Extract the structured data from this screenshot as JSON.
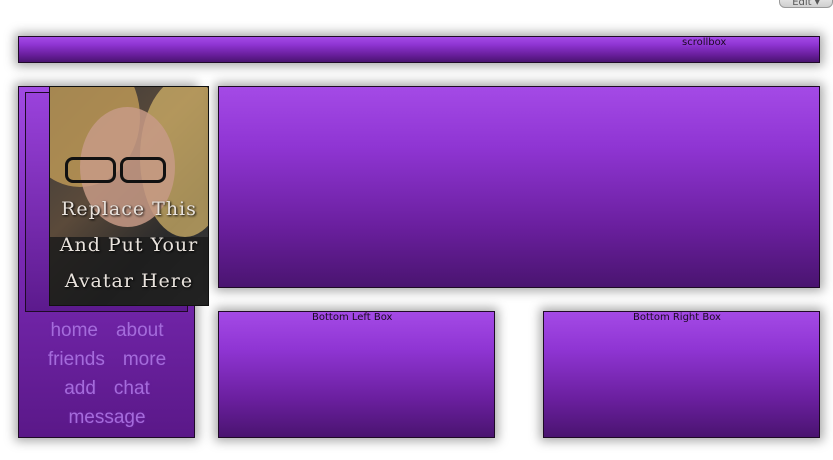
{
  "toolbar": {
    "edit_label": "Edit ▾"
  },
  "scrollbox": {
    "label": "scrollbox"
  },
  "avatar": {
    "placeholder_lines": [
      "Replace This",
      "And Put Your",
      "Avatar Here"
    ]
  },
  "nav": {
    "links": [
      "home",
      "about",
      "friends",
      "more",
      "add",
      "chat",
      "message"
    ]
  },
  "boxes": {
    "bottom_left": "Bottom Left Box",
    "bottom_right": "Bottom Right Box"
  },
  "colors": {
    "box_top": "#a44ae6",
    "box_bottom": "#4a1470",
    "nav_link": "#a56bdc"
  }
}
